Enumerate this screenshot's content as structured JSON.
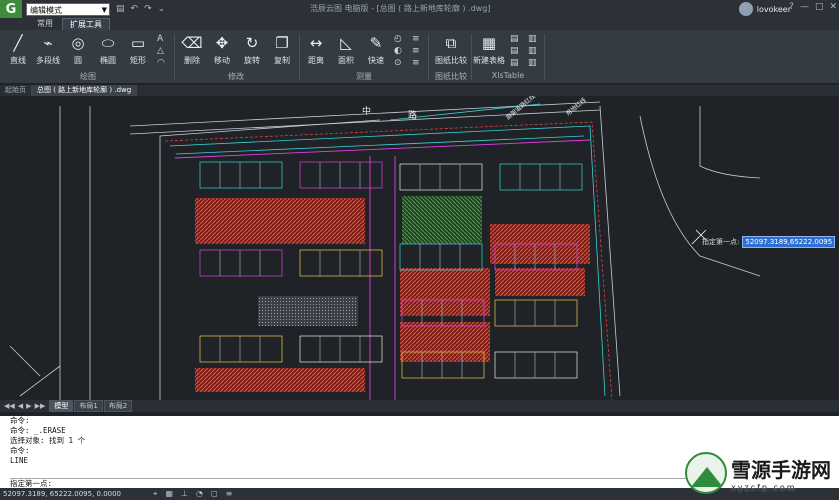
{
  "titlebar": {
    "logo": "G",
    "mode_select": "编辑模式",
    "doc_title": "浩辰云图 电脑版 - [总图 ( 路上新地库轮廓 ) .dwg]",
    "username": "lovokeer",
    "controls": [
      "?",
      "—",
      "□",
      "✕"
    ]
  },
  "ribbon_tabs": [
    "常用",
    "扩展工具"
  ],
  "ribbon": {
    "draw": {
      "line": "直线",
      "polyline": "多段线",
      "circle": "圆",
      "ellipse": "椭圆",
      "rect": "矩形",
      "group": "绘图"
    },
    "modify": {
      "erase": "删除",
      "move": "移动",
      "rotate": "旋转",
      "copy": "复制",
      "group": "修改"
    },
    "measure": {
      "distance": "距离",
      "area": "面积",
      "quick": "快速",
      "group": "测量"
    },
    "compare": {
      "label": "图纸比较",
      "group": "图纸比较"
    },
    "xls": {
      "label": "新建表格",
      "group": "XlsTable"
    }
  },
  "doc_tabs": [
    "起始页",
    "总图 ( 路上新地库轮廓 ) .dwg"
  ],
  "drawing": {
    "road_labels": [
      "中",
      "路"
    ],
    "side_labels": [
      "高架道路红线",
      "用地红线"
    ]
  },
  "coord_prompt": {
    "label": "指定第一点:",
    "value": "52097.3189,65222.0095"
  },
  "layout_tabs": [
    "模型",
    "布局1",
    "布局2"
  ],
  "command_lines": [
    "命令:",
    "命令: _.ERASE",
    "选择对象: 找到 1 个",
    "命令:",
    "LINE"
  ],
  "command_prompt": "指定第一点:",
  "status": {
    "coords": "52097.3189, 65222.0095, 0.0000"
  },
  "watermark": {
    "name": "雪源手游网",
    "url": "xyzcfp.com"
  },
  "colors": {
    "canvas": "#1f2327",
    "accent_cyan": "#38d4d4",
    "accent_magenta": "#e040e0",
    "hatch_red": "#c0392b",
    "hatch_green": "#3a7a3a",
    "prompt_bg": "#2f6fd0"
  }
}
